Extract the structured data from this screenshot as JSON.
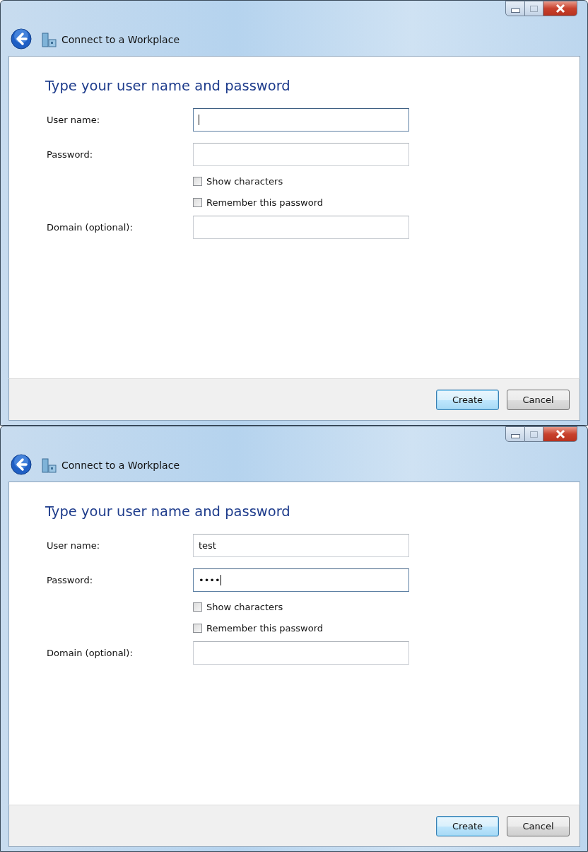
{
  "windows": [
    {
      "title": "Connect to a Workplace",
      "heading": "Type your user name and password",
      "fields": [
        {
          "label": "User name:",
          "focused": true
        },
        {
          "label": "Password:",
          "focused": false
        }
      ],
      "checkboxes": [
        {
          "label": "Show characters",
          "checked": false
        },
        {
          "label": "Remember this password",
          "checked": false
        }
      ],
      "domain": {
        "label": "Domain (optional):",
        "focused": false
      },
      "buttons": [
        {
          "label": "Create",
          "default": true
        },
        {
          "label": "Cancel",
          "default": false
        }
      ]
    },
    {
      "title": "Connect to a Workplace",
      "heading": "Type your user name and password",
      "fields": [
        {
          "label": "User name:",
          "value": "test",
          "focused": false
        },
        {
          "label": "Password:",
          "value": "••••",
          "focused": true
        }
      ],
      "checkboxes": [
        {
          "label": "Show characters",
          "checked": false
        },
        {
          "label": "Remember this password",
          "checked": false
        }
      ],
      "domain": {
        "label": "Domain (optional):",
        "focused": false
      },
      "buttons": [
        {
          "label": "Create",
          "default": true
        },
        {
          "label": "Cancel",
          "default": false
        }
      ]
    }
  ]
}
